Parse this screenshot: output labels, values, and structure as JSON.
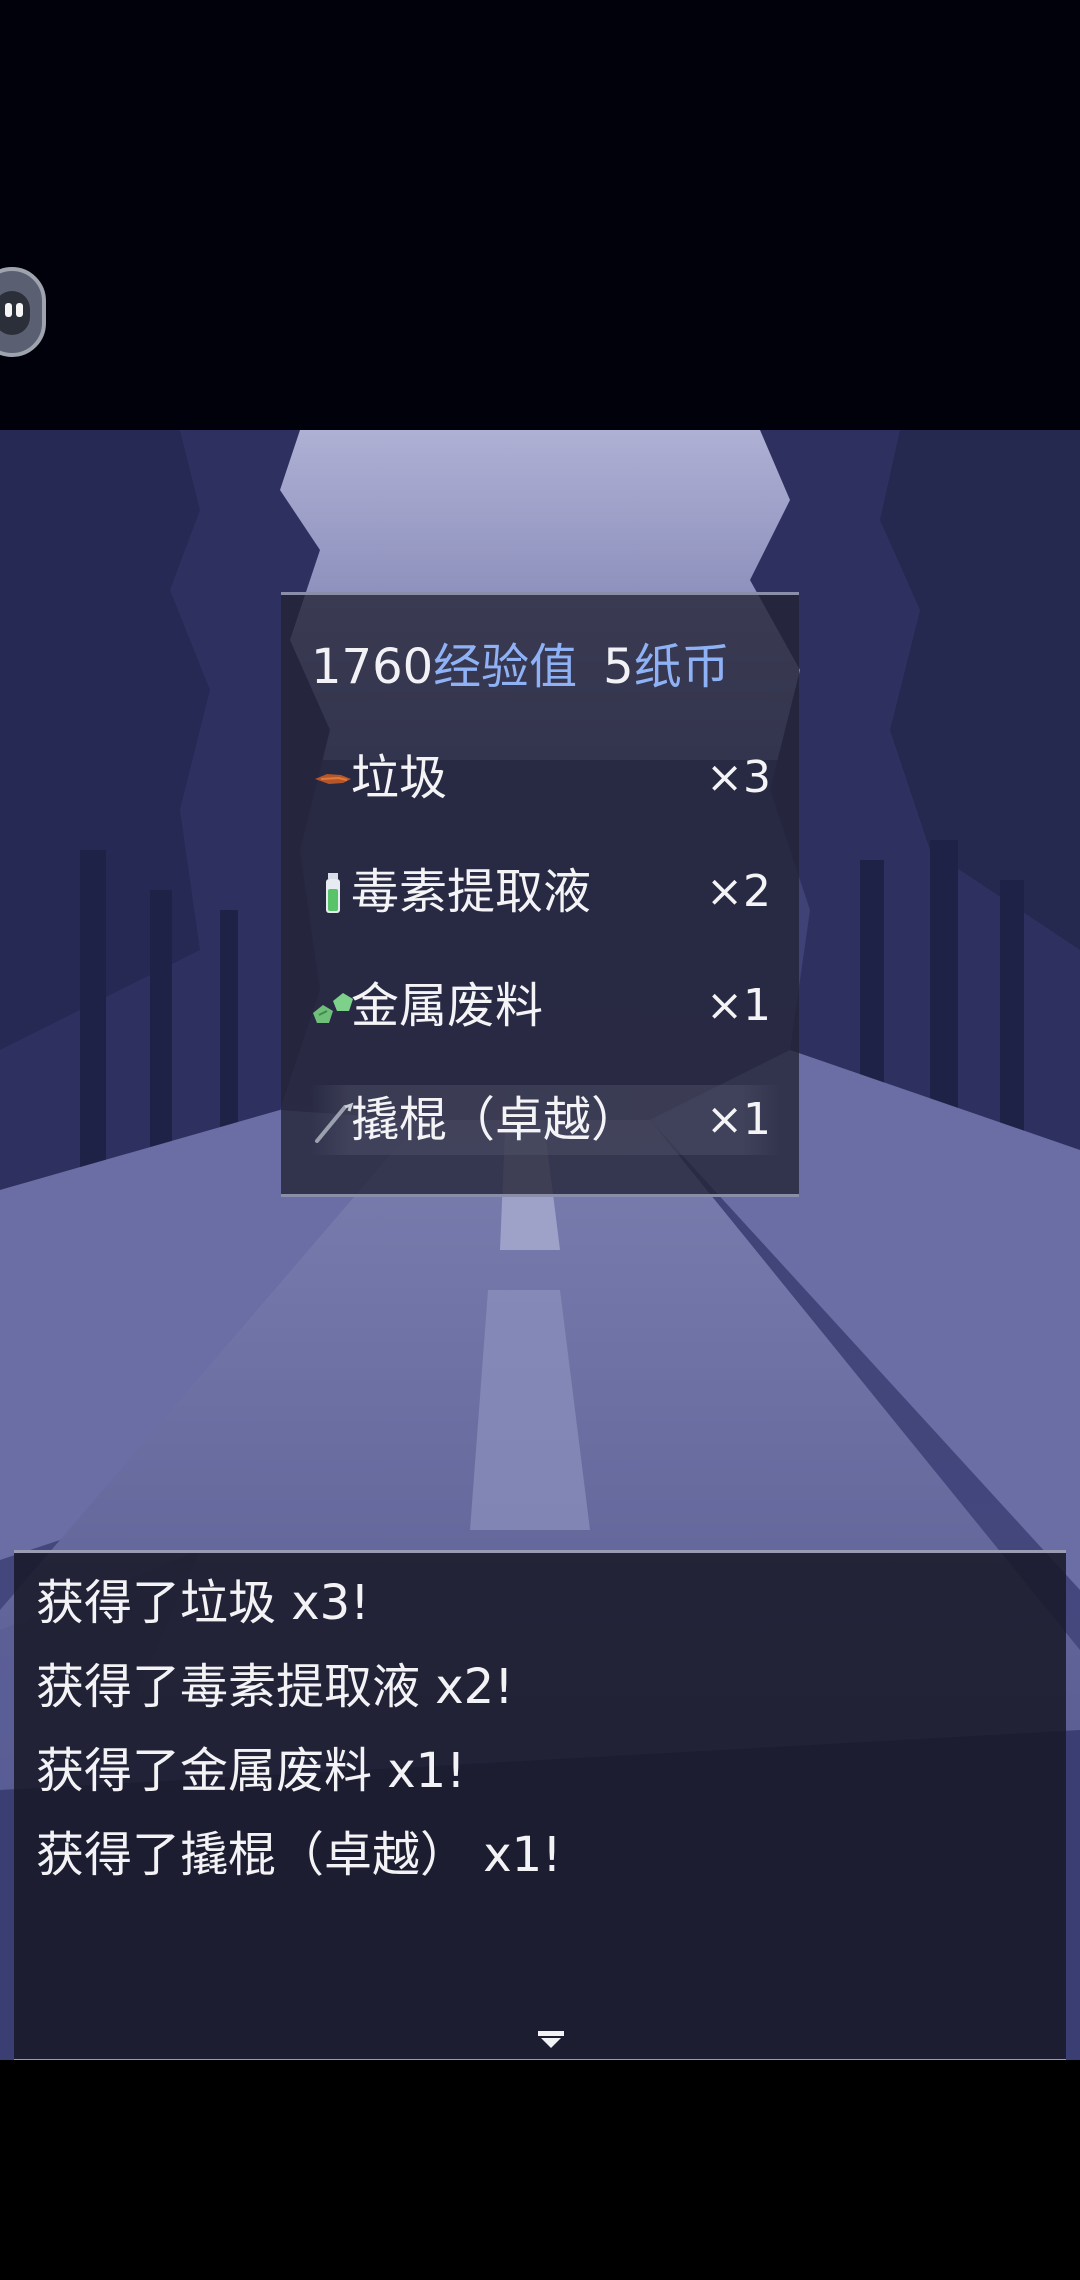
{
  "rewards": {
    "exp_value": "1760",
    "exp_label": "经验值",
    "money_value": "5",
    "money_label": "纸币",
    "items": [
      {
        "name": "垃圾",
        "qty": "×3",
        "icon": "trash-icon"
      },
      {
        "name": "毒素提取液",
        "qty": "×2",
        "icon": "vial-icon"
      },
      {
        "name": "金属废料",
        "qty": "×1",
        "icon": "scrap-icon"
      },
      {
        "name": "撬棍（卓越）",
        "qty": "×1",
        "icon": "crowbar-icon"
      }
    ]
  },
  "messages": [
    "获得了垃圾 x3!",
    "获得了毒素提取液 x2!",
    "获得了金属废料 x1!",
    "获得了撬棍（卓越） x1!"
  ],
  "colors": {
    "scene_sky": "#8c8fb9",
    "scene_trees": "#2d3058",
    "scene_road": "#5a5f95",
    "accent_blue": "#8fb1f5",
    "window_bg": "#222334",
    "text": "#f4f4f7"
  }
}
